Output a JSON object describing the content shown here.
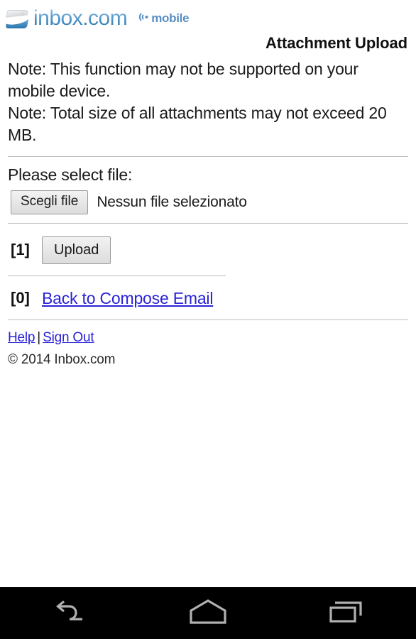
{
  "header": {
    "logo_icon": "inbox-logo-icon",
    "logo_text": "inbox.com",
    "mobile_badge_icon": "wifi-signal-icon",
    "mobile_badge_text": "mobile"
  },
  "page_title": "Attachment Upload",
  "notes": {
    "line1": "Note: This function may not be supported on your mobile device.",
    "line2": "Note: Total size of all attachments may not exceed 20 MB."
  },
  "file_section": {
    "label": "Please select file:",
    "choose_button": "Scegli file",
    "file_status": "Nessun file selezionato"
  },
  "upload_section": {
    "key": "[1]",
    "button_label": "Upload"
  },
  "back_section": {
    "key": "[0]",
    "link_label": "Back to Compose Email"
  },
  "footer": {
    "help_label": "Help",
    "separator": "|",
    "signout_label": "Sign Out",
    "copyright": "© 2014 Inbox.com"
  },
  "navbar": {
    "back_icon": "back-arrow-icon",
    "home_icon": "home-icon",
    "recents_icon": "recent-apps-icon"
  },
  "colors": {
    "link": "#2a22d6",
    "brand_blue": "#4a91c4",
    "divider": "#bdbdbd",
    "navbar_bg": "#000000",
    "nav_icon": "#b0b0b0"
  }
}
